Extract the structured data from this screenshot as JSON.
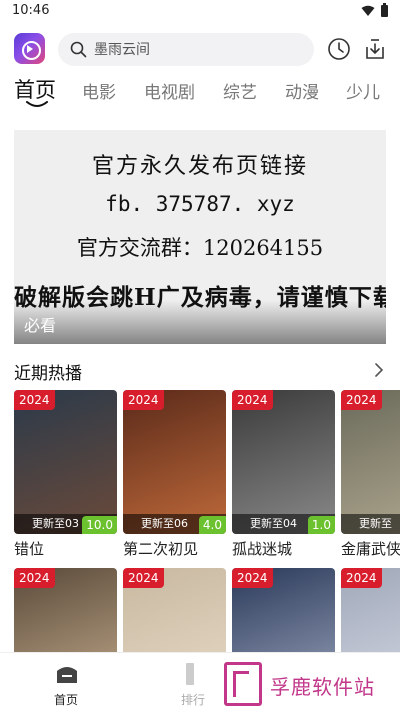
{
  "status_bar": {
    "time": "10:46"
  },
  "search": {
    "placeholder": "墨雨云间"
  },
  "tabs": [
    {
      "label": "首页",
      "active": true
    },
    {
      "label": "电影"
    },
    {
      "label": "电视剧"
    },
    {
      "label": "综艺"
    },
    {
      "label": "动漫"
    },
    {
      "label": "少儿"
    }
  ],
  "banner": {
    "lines": [
      "官方永久发布页链接",
      "fb. 375787. xyz",
      "官方交流群：120264155",
      "破解版会跳H广及病毒，请谨慎下载"
    ],
    "caption": "必看"
  },
  "section": {
    "title": "近期热播"
  },
  "cards": [
    {
      "year": "2024",
      "update": "更新至03",
      "score": "10.0",
      "title": "错位",
      "poster_colors": [
        "#2b3a4a",
        "#6b4a3a"
      ]
    },
    {
      "year": "2024",
      "update": "更新至06",
      "score": "4.0",
      "title": "第二次初见",
      "poster_colors": [
        "#5a2a1a",
        "#c06a3a"
      ]
    },
    {
      "year": "2024",
      "update": "更新至04",
      "score": "1.0",
      "title": "孤战迷城",
      "poster_colors": [
        "#3a3a3a",
        "#8a8a8a"
      ]
    },
    {
      "year": "2024",
      "update": "更新至",
      "score": "",
      "title": "金庸武侠",
      "poster_colors": [
        "#6a6a5a",
        "#b0a890"
      ]
    },
    {
      "year": "2024",
      "update": "",
      "score": "",
      "title": "",
      "poster_colors": [
        "#5a4a3a",
        "#c8b090"
      ]
    },
    {
      "year": "2024",
      "update": "",
      "score": "",
      "title": "",
      "poster_colors": [
        "#c8b8a0",
        "#e8dcc8"
      ]
    },
    {
      "year": "2024",
      "update": "",
      "score": "",
      "title": "",
      "poster_colors": [
        "#2a3a5a",
        "#a0a8c0"
      ]
    },
    {
      "year": "2024",
      "update": "",
      "score": "",
      "title": "",
      "poster_colors": [
        "#a0a8b8",
        "#d8dce8"
      ]
    }
  ],
  "bottom_nav": {
    "home_label": "首页",
    "rank_label": "排行"
  },
  "watermark": {
    "text": "孚鹿软件站"
  },
  "colors": {
    "accent_red": "#d81e2c",
    "score_green": "#6cc22e",
    "watermark": "#c2378a"
  }
}
